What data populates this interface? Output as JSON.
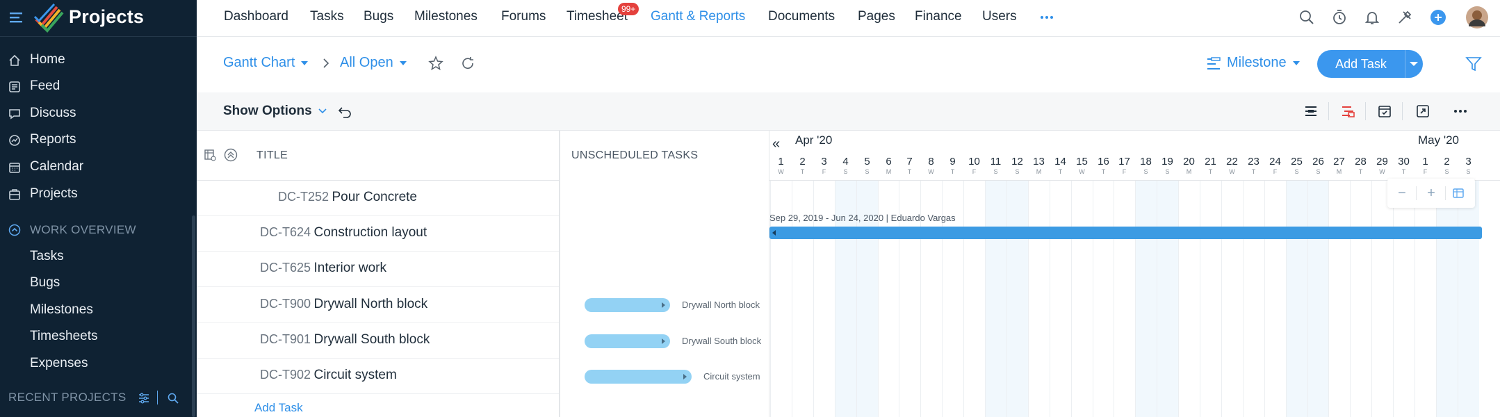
{
  "app": {
    "title": "Projects"
  },
  "sidebar": {
    "items": [
      {
        "label": "Home",
        "icon": "home-icon"
      },
      {
        "label": "Feed",
        "icon": "feed-icon"
      },
      {
        "label": "Discuss",
        "icon": "discuss-icon"
      },
      {
        "label": "Reports",
        "icon": "reports-icon"
      },
      {
        "label": "Calendar",
        "icon": "calendar-icon"
      },
      {
        "label": "Projects",
        "icon": "projects-icon"
      }
    ],
    "work_overview": {
      "label": "WORK OVERVIEW",
      "items": [
        "Tasks",
        "Bugs",
        "Milestones",
        "Timesheets",
        "Expenses"
      ]
    },
    "recent_projects": "RECENT PROJECTS"
  },
  "topnav": {
    "items": [
      "Dashboard",
      "Tasks",
      "Bugs",
      "Milestones",
      "Forums",
      "Timesheet",
      "Gantt & Reports",
      "Documents",
      "Pages",
      "Finance",
      "Users"
    ],
    "active": "Gantt & Reports",
    "timesheet_badge": "99+"
  },
  "toolbar": {
    "view": "Gantt Chart",
    "filter": "All Open",
    "group_by": "Milestone",
    "add_task": "Add Task",
    "show_options": "Show Options"
  },
  "table": {
    "title_header": "TITLE",
    "unscheduled_header": "UNSCHEDULED TASKS",
    "rows": [
      {
        "id": "DC-T252",
        "name": "Pour Concrete"
      },
      {
        "id": "DC-T624",
        "name": "Construction layout"
      },
      {
        "id": "DC-T625",
        "name": "Interior work"
      },
      {
        "id": "DC-T900",
        "name": "Drywall North block"
      },
      {
        "id": "DC-T901",
        "name": "Drywall South block"
      },
      {
        "id": "DC-T902",
        "name": "Circuit system"
      }
    ],
    "add_task": "Add Task"
  },
  "unscheduled": [
    {
      "label": "Drywall North block"
    },
    {
      "label": "Drywall South block"
    },
    {
      "label": "Circuit system"
    }
  ],
  "gantt": {
    "months": [
      "Apr '20",
      "May '20"
    ],
    "days": [
      {
        "n": "1",
        "w": "W"
      },
      {
        "n": "2",
        "w": "T"
      },
      {
        "n": "3",
        "w": "F"
      },
      {
        "n": "4",
        "w": "S"
      },
      {
        "n": "5",
        "w": "S"
      },
      {
        "n": "6",
        "w": "M"
      },
      {
        "n": "7",
        "w": "T"
      },
      {
        "n": "8",
        "w": "W"
      },
      {
        "n": "9",
        "w": "T"
      },
      {
        "n": "10",
        "w": "F"
      },
      {
        "n": "11",
        "w": "S"
      },
      {
        "n": "12",
        "w": "S"
      },
      {
        "n": "13",
        "w": "M"
      },
      {
        "n": "14",
        "w": "T"
      },
      {
        "n": "15",
        "w": "W"
      },
      {
        "n": "16",
        "w": "T"
      },
      {
        "n": "17",
        "w": "F"
      },
      {
        "n": "18",
        "w": "S"
      },
      {
        "n": "19",
        "w": "S"
      },
      {
        "n": "20",
        "w": "M"
      },
      {
        "n": "21",
        "w": "T"
      },
      {
        "n": "22",
        "w": "W"
      },
      {
        "n": "23",
        "w": "T"
      },
      {
        "n": "24",
        "w": "F"
      },
      {
        "n": "25",
        "w": "S"
      },
      {
        "n": "26",
        "w": "S"
      },
      {
        "n": "27",
        "w": "M"
      },
      {
        "n": "28",
        "w": "T"
      },
      {
        "n": "29",
        "w": "W"
      },
      {
        "n": "30",
        "w": "T"
      },
      {
        "n": "1",
        "w": "F"
      },
      {
        "n": "2",
        "w": "S"
      },
      {
        "n": "3",
        "w": "S"
      }
    ],
    "project_bar_label": "Sep 29, 2019 - Jun 24, 2020 | Eduardo Vargas"
  },
  "colors": {
    "accent": "#2e8fe8",
    "sidebar": "#0f2233",
    "bar": "#3c9be3",
    "unscheduled_bar": "#93d2f4"
  }
}
